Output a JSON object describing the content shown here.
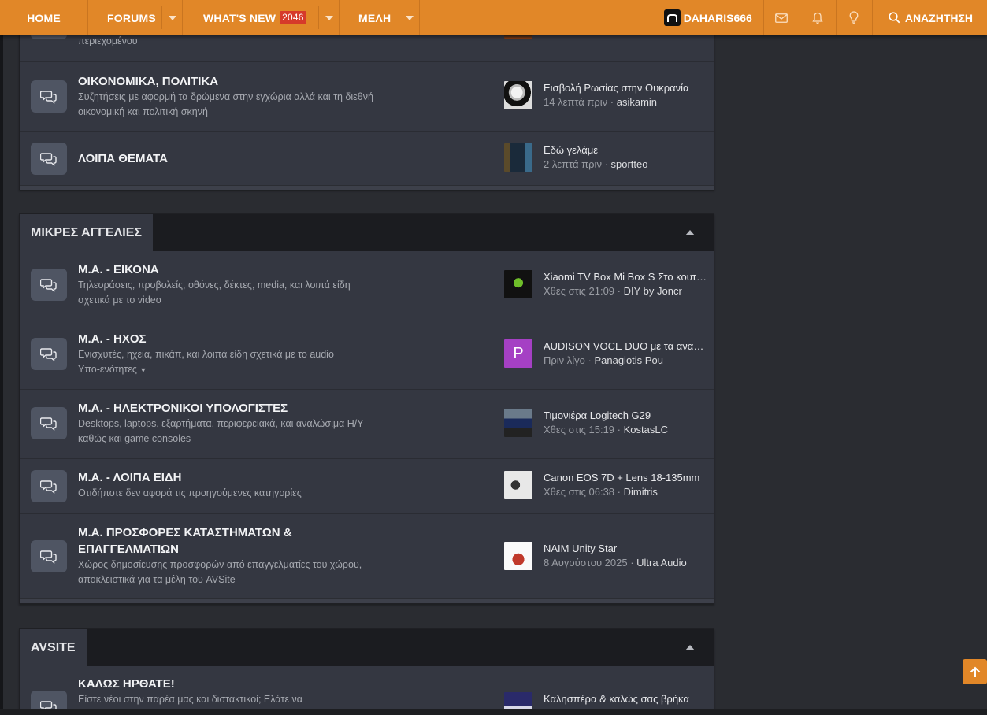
{
  "nav": {
    "home": "HOME",
    "forums": "FORUMS",
    "whats_new": "WHAT'S NEW",
    "whats_new_badge": "2046",
    "members": "ΜΕΛΗ",
    "username": "DAHARIS666",
    "search": "ΑΝΑΖΗΤΗΣΗ"
  },
  "block1": {
    "partial_desc": "περιεχομένου",
    "nodes": [
      {
        "title": "ΟΙΚΟΝΟΜΙΚΑ, ΠΟΛΙΤΙΚΑ",
        "desc": "Συζητήσεις με αφορμή τα δρώμενα στην εγχώρια αλλά και τη διεθνή οικονομική και πολιτική σκηνή",
        "latest_title": "Εισβολή Ρωσίας στην Ουκρανία",
        "latest_time": "14 λεπτά πριν",
        "latest_user": "asikamin"
      },
      {
        "title": "ΛΟΙΠΑ ΘΕΜΑΤΑ",
        "desc": "",
        "latest_title": "Εδώ γελάμε",
        "latest_time": "2 λεπτά πριν",
        "latest_user": "sportteo"
      }
    ]
  },
  "block2": {
    "title": "ΜΙΚΡΕΣ ΑΓΓΕΛΙΕΣ",
    "nodes": [
      {
        "title": "Μ.Α. - ΕΙΚΟΝΑ",
        "desc": "Τηλεοράσεις, προβολείς, οθόνες, δέκτες, media, και λοιπά είδη σχετικά με το video",
        "latest_title": "Xiaomi TV Box Mi Box S Στο κουτί του",
        "latest_time": "Χθες στις 21:09",
        "latest_user": "DIY by Joncr"
      },
      {
        "title": "Μ.Α. - ΗΧΟΣ",
        "desc": "Ενισχυτές, ηχεία, πικάπ, και λοιπά είδη σχετικά με το audio",
        "subforums": "Υπο-ενότητες",
        "latest_title": "AUDISON VOCE DUO με τα αναλογικά",
        "latest_time": "Πριν λίγο",
        "latest_user": "Panagiotis Pou",
        "avatar_letter": "P"
      },
      {
        "title": "Μ.Α. - ΗΛΕΚΤΡΟΝΙΚΟΙ ΥΠΟΛΟΓΙΣΤΕΣ",
        "desc": "Desktops, laptops, εξαρτήματα, περιφερειακά, και αναλώσιμα Η/Υ καθώς και game consoles",
        "latest_title": "Τιμονιέρα Logitech G29",
        "latest_time": "Χθες στις 15:19",
        "latest_user": "KostasLC"
      },
      {
        "title": "Μ.Α. - ΛΟΙΠΑ ΕΙΔΗ",
        "desc": "Οτιδήποτε δεν αφορά τις προηγούμενες κατηγορίες",
        "latest_title": "Canon EOS 7D + Lens 18-135mm",
        "latest_time": "Χθες στις 06:38",
        "latest_user": "Dimitris"
      },
      {
        "title": "Μ.Α. ΠΡΟΣΦΟΡΕΣ ΚΑΤΑΣΤΗΜΑΤΩΝ & ΕΠΑΓΓΕΛΜΑΤΙΩΝ",
        "desc": "Χώρος δημοσίευσης προσφορών από επαγγελματίες του χώρου, αποκλειστικά για τα μέλη του AVSite",
        "latest_title": "NAIM Unity Star",
        "latest_time": "8 Αυγούστου 2025",
        "latest_user": "Ultra Audio"
      }
    ]
  },
  "block3": {
    "title": "AVSITE",
    "nodes": [
      {
        "title": "ΚΑΛΩΣ ΗΡΘΑΤΕ!",
        "desc": "Είστε νέοι στην παρέα μας και διστακτικοί; Ελάτε να",
        "latest_title": "Καλησπέρα & καλώς σας βρήκα"
      }
    ]
  },
  "colors": {
    "accent": "#e18728",
    "badge": "#d63a2a",
    "page_bg": "#2a2c31",
    "block_bg": "#343741"
  }
}
